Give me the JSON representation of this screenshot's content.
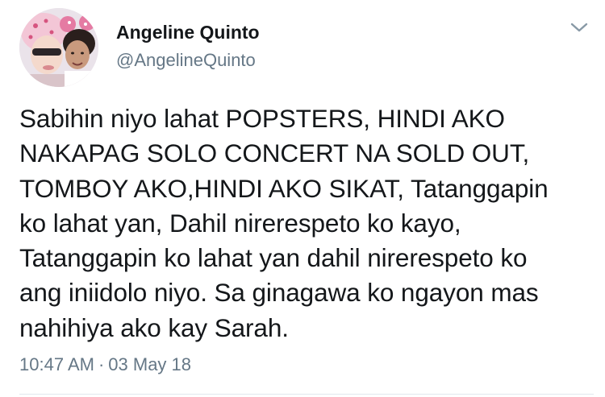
{
  "author": {
    "display_name": "Angeline Quinto",
    "handle": "@AngelineQuinto",
    "avatar_icon": "profile-photo"
  },
  "menu": {
    "icon": "chevron-down-icon",
    "color": "#8899a6"
  },
  "tweet": {
    "text": "Sabihin niyo lahat POPSTERS, HINDI AKO\nNAKAPAG SOLO CONCERT NA SOLD OUT,\nTOMBOY AKO,HINDI AKO SIKAT, Tatanggapin\nko lahat yan, Dahil nirerespeto ko kayo,\nTatanggapin ko lahat yan dahil nirerespeto ko\nang iniidolo niyo. Sa ginagawa ko ngayon mas\nnahihiya ako kay Sarah.",
    "time": "10:47 AM",
    "separator": "·",
    "date": "03 May 18"
  },
  "colors": {
    "text_primary": "#14171a",
    "text_secondary": "#657786",
    "divider": "#e1e8ed"
  }
}
